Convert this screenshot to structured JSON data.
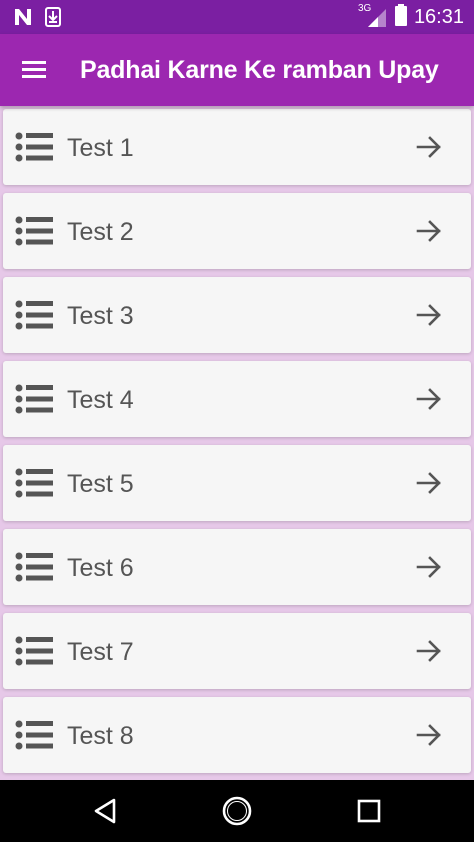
{
  "status_bar": {
    "time": "16:31",
    "network_label": "3G",
    "icons": [
      "n-notification-icon",
      "download-notification-icon",
      "signal-icon",
      "battery-icon"
    ]
  },
  "app_bar": {
    "title": "Padhai Karne Ke ramban Upay",
    "menu_icon": "hamburger-menu-icon",
    "background": "#9c27b0",
    "status_background": "#7b1fa2"
  },
  "tests": {
    "items": [
      {
        "label": "Test 1"
      },
      {
        "label": "Test 2"
      },
      {
        "label": "Test 3"
      },
      {
        "label": "Test 4"
      },
      {
        "label": "Test 5"
      },
      {
        "label": "Test 6"
      },
      {
        "label": "Test 7"
      },
      {
        "label": "Test 8"
      }
    ],
    "item_icon": "list-bullets-icon",
    "action_icon": "arrow-right-icon"
  },
  "nav_bar": {
    "buttons": [
      "back-icon",
      "home-icon",
      "recents-icon"
    ]
  }
}
